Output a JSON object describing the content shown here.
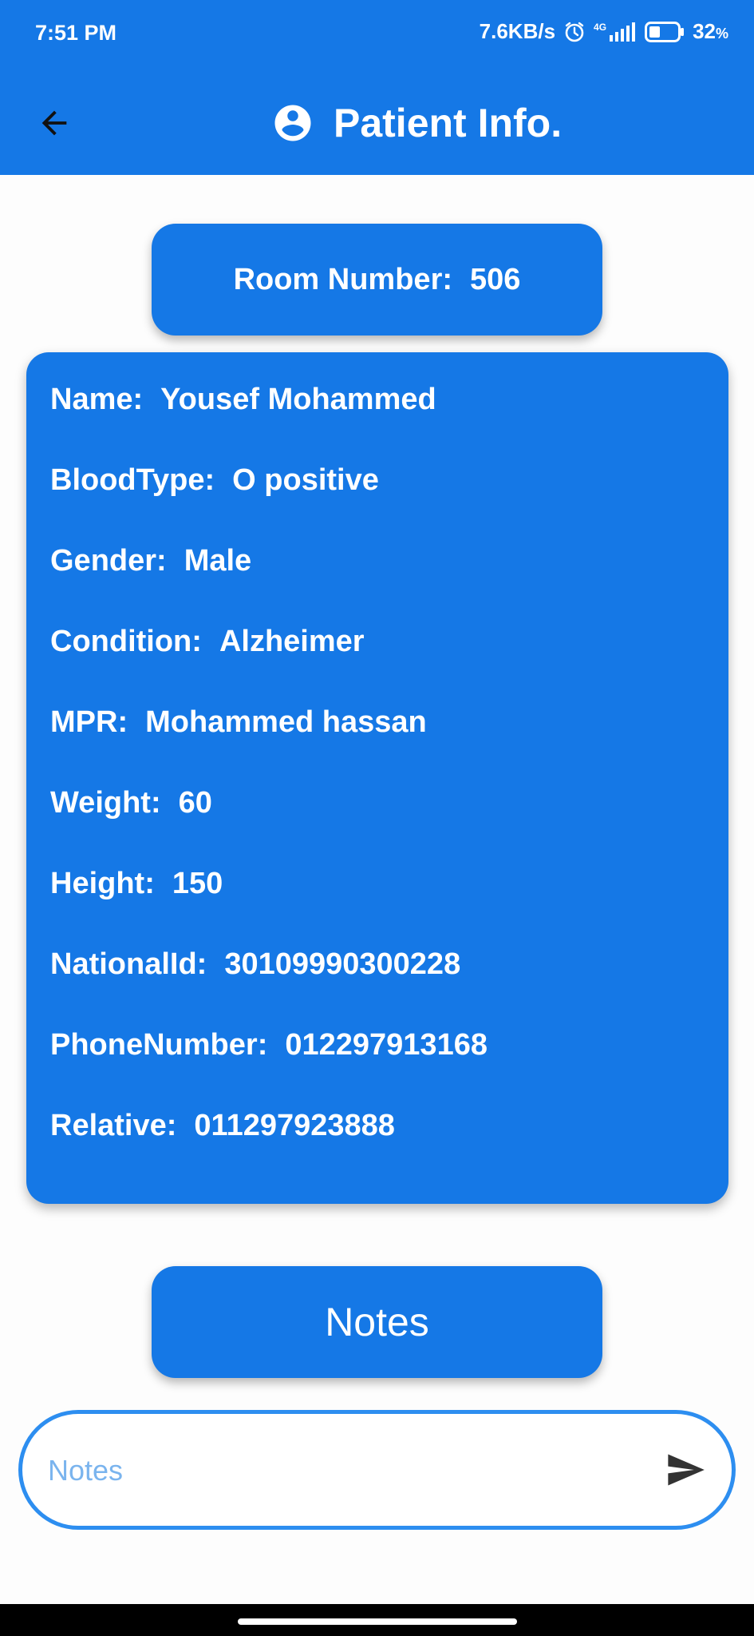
{
  "status_bar": {
    "time": "7:51 PM",
    "network_speed": "7.6KB/s",
    "network_type": "4G",
    "battery": "32",
    "battery_unit": "%",
    "icons": [
      "alarm-icon",
      "signal-icon",
      "battery-icon"
    ]
  },
  "app_bar": {
    "title": "Patient Info.",
    "back_icon": "arrow-left-icon",
    "title_icon": "account-circle-icon"
  },
  "room": {
    "label": "Room Number:",
    "value": "506"
  },
  "patient": {
    "fields": [
      {
        "label": "Name:",
        "value": "Yousef Mohammed"
      },
      {
        "label": "BloodType:",
        "value": "O positive"
      },
      {
        "label": "Gender:",
        "value": "Male"
      },
      {
        "label": "Condition:",
        "value": "Alzheimer"
      },
      {
        "label": "MPR:",
        "value": "Mohammed hassan"
      },
      {
        "label": "Weight:",
        "value": "60"
      },
      {
        "label": "Height:",
        "value": "150"
      },
      {
        "label": "NationalId:",
        "value": "30109990300228"
      },
      {
        "label": "PhoneNumber:",
        "value": "012297913168"
      },
      {
        "label": "Relative:",
        "value": "011297923888"
      }
    ]
  },
  "notes": {
    "button_label": "Notes",
    "input_placeholder": "Notes",
    "input_value": "",
    "send_icon": "send-icon"
  },
  "colors": {
    "primary": "#1578e6",
    "input_border": "#2d8ef0",
    "placeholder": "#7ab4ee",
    "background": "#fdfdfd"
  }
}
